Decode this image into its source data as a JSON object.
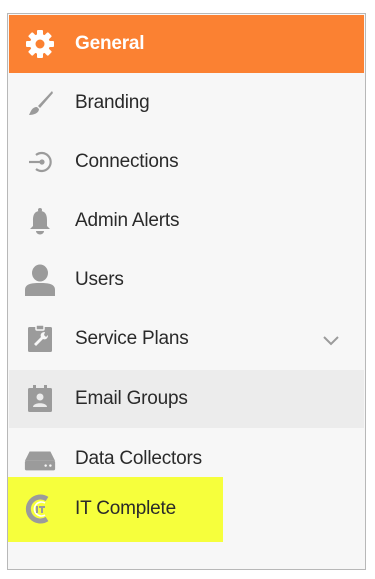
{
  "menu": {
    "items": [
      {
        "label": "General",
        "icon": "gear-icon"
      },
      {
        "label": "Branding",
        "icon": "brush-icon"
      },
      {
        "label": "Connections",
        "icon": "connection-icon"
      },
      {
        "label": "Admin Alerts",
        "icon": "bell-icon"
      },
      {
        "label": "Users",
        "icon": "user-icon"
      },
      {
        "label": "Service Plans",
        "icon": "wrench-clipboard-icon"
      },
      {
        "label": "Email Groups",
        "icon": "contact-card-icon"
      },
      {
        "label": "Data Collectors",
        "icon": "server-icon"
      },
      {
        "label": "IT Complete",
        "icon": "it-complete-logo-icon"
      }
    ]
  },
  "colors": {
    "accent": "#fb8132",
    "highlight": "#f6ff3c",
    "icon_gray": "#9b9b9b",
    "selected_bg": "#ececec",
    "menu_bg": "#f7f7f7"
  }
}
